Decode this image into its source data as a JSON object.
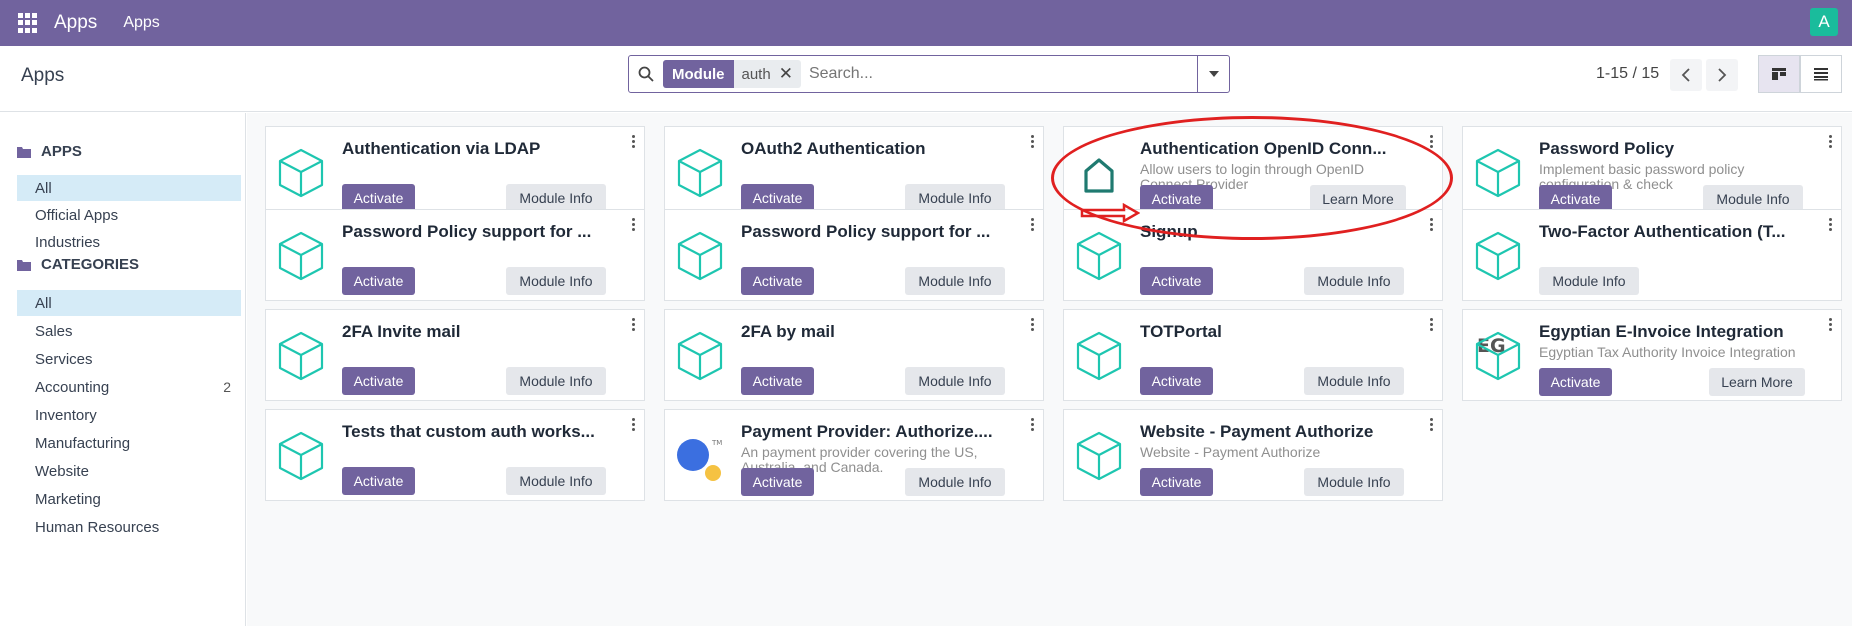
{
  "topbar": {
    "app_name": "Apps",
    "menu_apps": "Apps",
    "avatar_letter": "A"
  },
  "controlbar": {
    "breadcrumb": "Apps",
    "search": {
      "facet_label": "Module",
      "facet_value": "auth",
      "remove_glyph": "✕",
      "placeholder": "Search..."
    },
    "pager": "1-15 / 15"
  },
  "sidebar": {
    "apps_section": "APPS",
    "apps_items": [
      "All",
      "Official Apps",
      "Industries"
    ],
    "categories_section": "CATEGORIES",
    "category_items": [
      {
        "label": "All",
        "count": ""
      },
      {
        "label": "Sales",
        "count": ""
      },
      {
        "label": "Services",
        "count": ""
      },
      {
        "label": "Accounting",
        "count": "2"
      },
      {
        "label": "Inventory",
        "count": ""
      },
      {
        "label": "Manufacturing",
        "count": ""
      },
      {
        "label": "Website",
        "count": ""
      },
      {
        "label": "Marketing",
        "count": ""
      },
      {
        "label": "Human Resources",
        "count": ""
      }
    ]
  },
  "cards": [
    {
      "title": "Authentication via LDAP",
      "desc": "",
      "activate": "Activate",
      "info": "Module Info",
      "icon": "cube-icon"
    },
    {
      "title": "OAuth2 Authentication",
      "desc": "",
      "activate": "Activate",
      "info": "Module Info",
      "icon": "cube-icon"
    },
    {
      "title": "Authentication OpenID Conn...",
      "desc": "Allow users to login through OpenID Connect Provider",
      "activate": "Activate",
      "info": "Learn More",
      "icon": "house-icon"
    },
    {
      "title": "Password Policy",
      "desc": "Implement basic password policy configuration & check",
      "activate": "Activate",
      "info": "Module Info",
      "icon": "cube-icon"
    },
    {
      "title": "Password Policy support for ...",
      "desc": "",
      "activate": "Activate",
      "info": "Module Info",
      "icon": "cube-icon"
    },
    {
      "title": "Password Policy support for ...",
      "desc": "",
      "activate": "Activate",
      "info": "Module Info",
      "icon": "cube-icon"
    },
    {
      "title": "Signup",
      "desc": "",
      "activate": "Activate",
      "info": "Module Info",
      "icon": "cube-icon"
    },
    {
      "title": "Two-Factor Authentication (T...",
      "desc": "",
      "activate": "",
      "info": "Module Info",
      "icon": "cube-icon"
    },
    {
      "title": "2FA Invite mail",
      "desc": "",
      "activate": "Activate",
      "info": "Module Info",
      "icon": "cube-icon"
    },
    {
      "title": "2FA by mail",
      "desc": "",
      "activate": "Activate",
      "info": "Module Info",
      "icon": "cube-icon"
    },
    {
      "title": "TOTPortal",
      "desc": "",
      "activate": "Activate",
      "info": "Module Info",
      "icon": "cube-icon"
    },
    {
      "title": "Egyptian E-Invoice Integration",
      "desc": "Egyptian Tax Authority Invoice Integration",
      "activate": "Activate",
      "info": "Learn More",
      "icon": "eg-logo-icon",
      "logo_text": "EG"
    },
    {
      "title": "Tests that custom auth works...",
      "desc": "",
      "activate": "Activate",
      "info": "Module Info",
      "icon": "cube-icon"
    },
    {
      "title": "Payment Provider: Authorize....",
      "desc": "An payment provider covering the US, Australia, and Canada.",
      "activate": "Activate",
      "info": "Module Info",
      "icon": "authorize-logo-icon"
    },
    {
      "title": "Website - Payment Authorize",
      "desc": "Website - Payment Authorize",
      "activate": "Activate",
      "info": "Module Info",
      "icon": "cube-icon"
    }
  ],
  "colors": {
    "brand": "#71639e",
    "cube": "#1ec6b0",
    "annotation": "#e02020"
  }
}
